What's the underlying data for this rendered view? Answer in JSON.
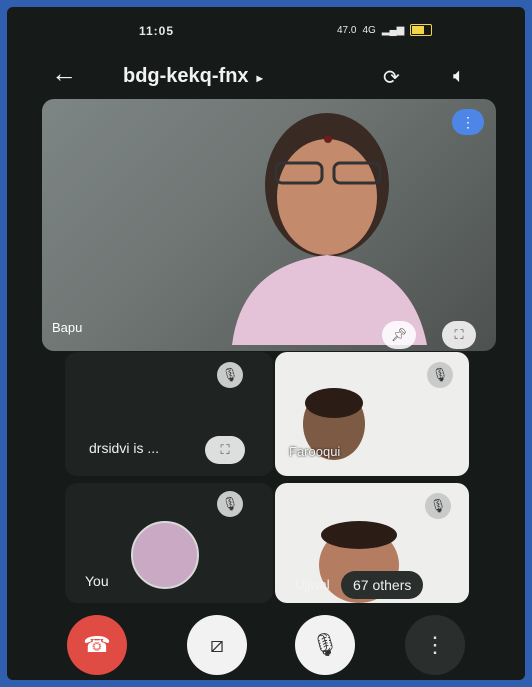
{
  "status": {
    "time": "11:05",
    "speed": "47.0",
    "net": "4G"
  },
  "meeting": {
    "code": "bdg-kekq-fnx",
    "caret": "▸"
  },
  "main_speaker": {
    "name": "Bapu"
  },
  "tiles": {
    "presenter_label": "drsidvi is ...",
    "tile2_name": "Farooqui",
    "you_label": "You",
    "tile4_name": "Ujjwal",
    "others_label": "67 others"
  },
  "icons": {
    "back": "arrow-left",
    "switch_camera": "camera-switch",
    "speaker": "volume",
    "pin": "pin",
    "fullscreen": "fullscreen",
    "mic_off": "mic-off",
    "video_off": "video-off",
    "end_call": "phone-hangup",
    "more": "more-vertical"
  },
  "colors": {
    "end_call": "#e04b43",
    "speaking_badge": "#4e86e8",
    "background": "#161a19"
  }
}
